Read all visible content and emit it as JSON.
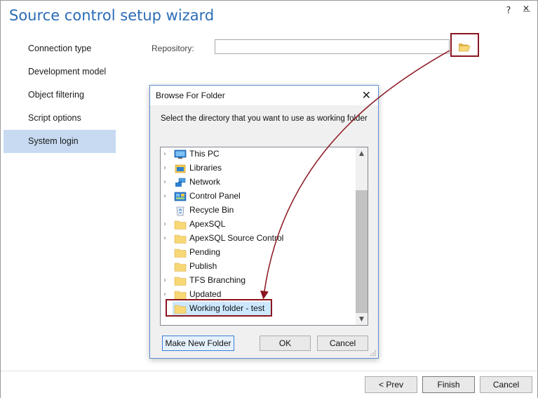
{
  "window": {
    "title": "Source control setup wizard",
    "help_label": "?",
    "minimize_label": "—",
    "close_label": "✕"
  },
  "sidebar": {
    "items": [
      {
        "label": "Connection type",
        "active": false
      },
      {
        "label": "Development model",
        "active": false
      },
      {
        "label": "Object filtering",
        "active": false
      },
      {
        "label": "Script options",
        "active": false
      },
      {
        "label": "System login",
        "active": true
      }
    ]
  },
  "main": {
    "repository_label": "Repository:",
    "repository_value": "",
    "browse_icon": "open-folder-icon"
  },
  "dialog": {
    "title": "Browse For Folder",
    "close_label": "✕",
    "description": "Select the directory that you want to use as working folder",
    "tree": [
      {
        "label": "This PC",
        "icon": "computer-icon",
        "expandable": true
      },
      {
        "label": "Libraries",
        "icon": "libraries-icon",
        "expandable": true
      },
      {
        "label": "Network",
        "icon": "network-icon",
        "expandable": true
      },
      {
        "label": "Control Panel",
        "icon": "control-panel-icon",
        "expandable": true
      },
      {
        "label": "Recycle Bin",
        "icon": "recycle-bin-icon",
        "expandable": false
      },
      {
        "label": "ApexSQL",
        "icon": "folder-icon",
        "expandable": true
      },
      {
        "label": "ApexSQL Source Control",
        "icon": "folder-icon",
        "expandable": true
      },
      {
        "label": "Pending",
        "icon": "folder-icon",
        "expandable": false
      },
      {
        "label": "Publish",
        "icon": "folder-icon",
        "expandable": false
      },
      {
        "label": "TFS Branching",
        "icon": "folder-icon",
        "expandable": true
      },
      {
        "label": "Updated",
        "icon": "folder-icon",
        "expandable": true
      },
      {
        "label": "Working folder - test",
        "icon": "folder-icon",
        "expandable": false,
        "selected": true
      }
    ],
    "make_new_folder_label": "Make New Folder",
    "ok_label": "OK",
    "cancel_label": "Cancel"
  },
  "footer": {
    "prev_label": "< Prev",
    "finish_label": "Finish",
    "cancel_label": "Cancel"
  },
  "colors": {
    "title": "#2b6cb6",
    "active_nav": "#c7daf1",
    "callout": "#8a1620",
    "selection": "#cce8ff",
    "folder": "#f8d775"
  }
}
